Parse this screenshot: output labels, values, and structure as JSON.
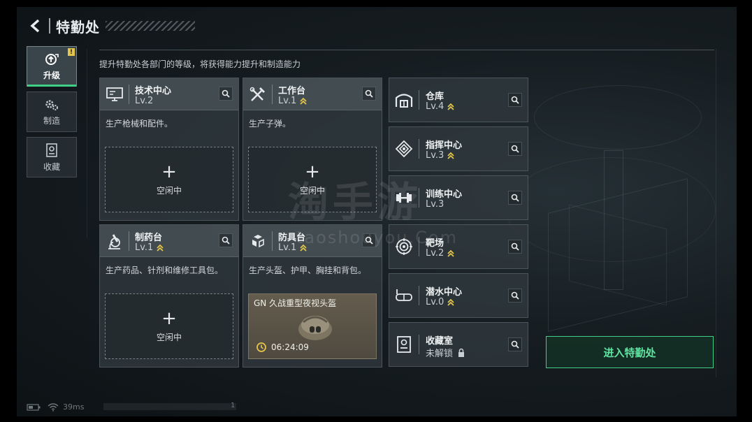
{
  "header": {
    "title": "特勤处"
  },
  "side_nav": [
    {
      "label": "升级",
      "icon": "upgrade-icon",
      "active": true,
      "badge": "!"
    },
    {
      "label": "制造",
      "icon": "gears-icon",
      "active": false
    },
    {
      "label": "收藏",
      "icon": "collection-icon",
      "active": false
    }
  ],
  "description": "提升特勤处各部门的等级，将获得能力提升和制造能力",
  "facilities": [
    {
      "name": "技术中心",
      "level": "Lv.2",
      "upgradable": false,
      "desc": "生产枪械和配件。",
      "icon": "computer-icon",
      "slot": {
        "plus": "+",
        "label": "空闲中"
      }
    },
    {
      "name": "工作台",
      "level": "Lv.1",
      "upgradable": true,
      "desc": "生产子弹。",
      "icon": "tools-icon",
      "slot": {
        "plus": "+",
        "label": "空闲中"
      }
    },
    {
      "name": "制药台",
      "level": "Lv.1",
      "upgradable": true,
      "desc": "生产药品、针剂和维修工具包。",
      "icon": "microscope-icon",
      "slot": {
        "plus": "+",
        "label": "空闲中"
      }
    },
    {
      "name": "防具台",
      "level": "Lv.1",
      "upgradable": true,
      "desc": "生产头盔、护甲、胸挂和背包。",
      "icon": "armor-icon",
      "crafting": {
        "item": "GN 久战重型夜视头盔",
        "timer": "06:24:09"
      }
    }
  ],
  "rooms": [
    {
      "name": "仓库",
      "level": "Lv.4",
      "upgradable": true,
      "icon": "warehouse-icon"
    },
    {
      "name": "指挥中心",
      "level": "Lv.3",
      "upgradable": true,
      "icon": "command-icon"
    },
    {
      "name": "训练中心",
      "level": "Lv.3",
      "upgradable": false,
      "icon": "dumbbell-icon"
    },
    {
      "name": "靶场",
      "level": "Lv.2",
      "upgradable": true,
      "icon": "target-icon"
    },
    {
      "name": "潜水中心",
      "level": "Lv.0",
      "upgradable": true,
      "icon": "diving-mask-icon"
    },
    {
      "name": "收藏室",
      "level": "未解锁",
      "locked": true,
      "icon": "display-case-icon"
    }
  ],
  "enter_button": "进入特勤处",
  "status": {
    "latency": "39ms",
    "page": "1"
  },
  "watermark": {
    "main": "淘手游",
    "sub": "taoshouyou.Com"
  },
  "colors": {
    "accent_green": "#3fcf85",
    "upgrade_gold": "#e2c54a",
    "badge_yellow": "#e2c54a"
  }
}
